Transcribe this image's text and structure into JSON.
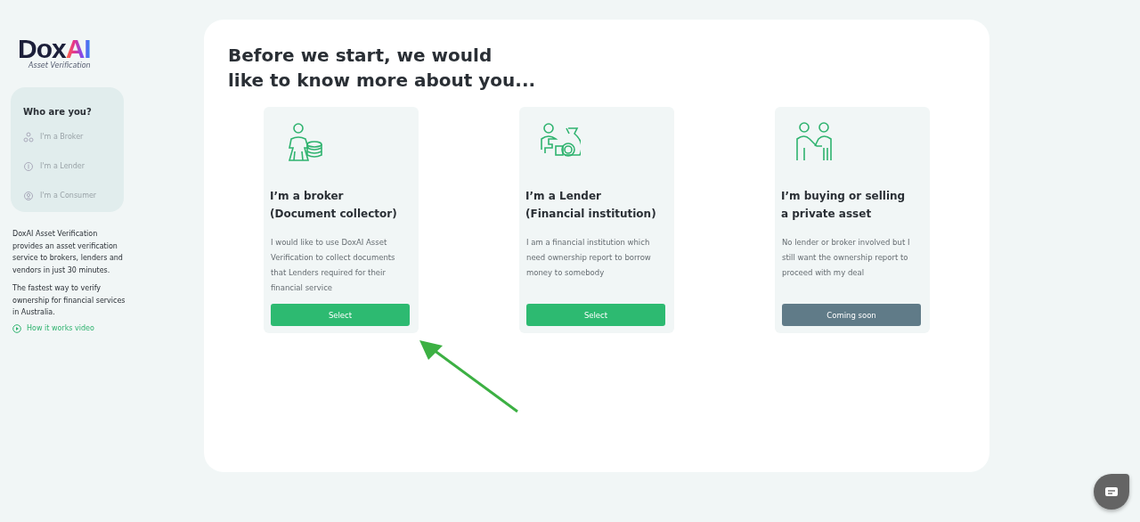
{
  "logo": {
    "word": "Dox",
    "accent": "AI",
    "subtitle": "Asset Verification"
  },
  "sidebar": {
    "title": "Who are you?",
    "items": [
      {
        "label": "I'm a Broker",
        "kind": "broker",
        "selected": false
      },
      {
        "label": "I'm a Lender",
        "kind": "lender",
        "selected": false
      },
      {
        "label": "I'm a Consumer",
        "kind": "consumer",
        "selected": false
      }
    ],
    "paragraphs": [
      "DoxAI Asset Verification provides an asset verification service to brokers, lenders and vendors in just 30 minutes.",
      "The fastest way to verify ownership for financial services in Australia."
    ],
    "video_link": "How it works video"
  },
  "heading": [
    "Before we start, we would",
    "like to know more about you..."
  ],
  "cards": [
    {
      "kind": "broker",
      "title": [
        "I’m a broker",
        "(Document collector)"
      ],
      "text": "I would like to use DoxAI Asset Verification to collect documents that Lenders required for their financial service",
      "button": {
        "label": "Select",
        "disabled": false
      }
    },
    {
      "kind": "lender",
      "title": [
        "I’m a Lender",
        "(Financial institution)"
      ],
      "text": "I am a financial institution which need ownership report to borrow money to somebody",
      "button": {
        "label": "Select",
        "disabled": false
      }
    },
    {
      "kind": "consumer",
      "title": [
        "I’m buying or selling",
        "a private asset"
      ],
      "text": "No lender or broker involved but I still want the ownership report to proceed with my deal",
      "button": {
        "label": "Coming soon",
        "disabled": true
      }
    }
  ],
  "annotation": {
    "kind": "arrow"
  }
}
